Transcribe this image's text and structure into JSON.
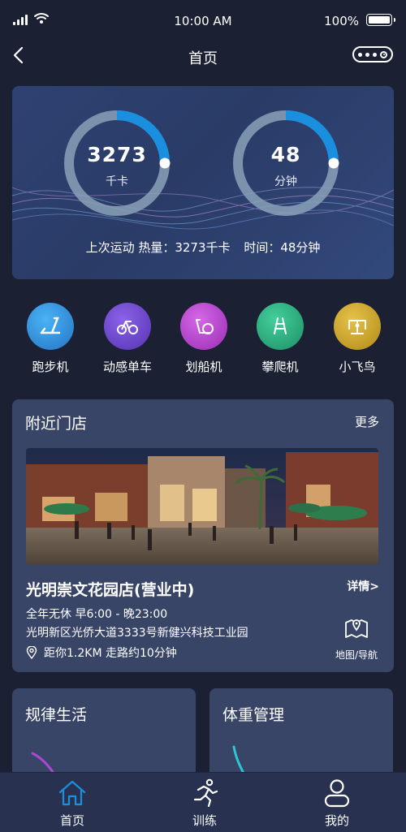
{
  "status_bar": {
    "time": "10:00 AM",
    "battery": "100%"
  },
  "nav": {
    "title": "首页"
  },
  "hero": {
    "calories": {
      "value": "3273",
      "unit": "千卡"
    },
    "duration": {
      "value": "48",
      "unit": "分钟"
    },
    "summary_label": "上次运动 热量：3273千卡",
    "summary_time": "时间：48分钟"
  },
  "categories": [
    {
      "label": "跑步机",
      "icon": "treadmill-icon",
      "color": "#2f8fd8"
    },
    {
      "label": "动感单车",
      "icon": "spin-bike-icon",
      "color": "#6a45c8"
    },
    {
      "label": "划船机",
      "icon": "rowing-machine-icon",
      "color": "#b03fc6"
    },
    {
      "label": "攀爬机",
      "icon": "climbing-machine-icon",
      "color": "#26a97c"
    },
    {
      "label": "小飞鸟",
      "icon": "flying-bird-machine-icon",
      "color": "#c9a326"
    }
  ],
  "store": {
    "section_title": "附近门店",
    "more": "更多",
    "name": "光明崇文花园店(营业中)",
    "detail": "详情>",
    "hours": "全年无休 早6:00 - 晚23:00",
    "address": "光明新区光侨大道3333号新健兴科技工业园",
    "distance": "距你1.2KM 走路约10分钟",
    "map_label": "地图/导航"
  },
  "cards": [
    {
      "title": "规律生活"
    },
    {
      "title": "体重管理"
    }
  ],
  "tabs": [
    {
      "label": "首页",
      "icon": "home-icon"
    },
    {
      "label": "训练",
      "icon": "running-icon"
    },
    {
      "label": "我的",
      "icon": "profile-icon"
    }
  ],
  "colors": {
    "accent": "#1a8fe0",
    "background": "#1b2033",
    "card": "#394567"
  }
}
